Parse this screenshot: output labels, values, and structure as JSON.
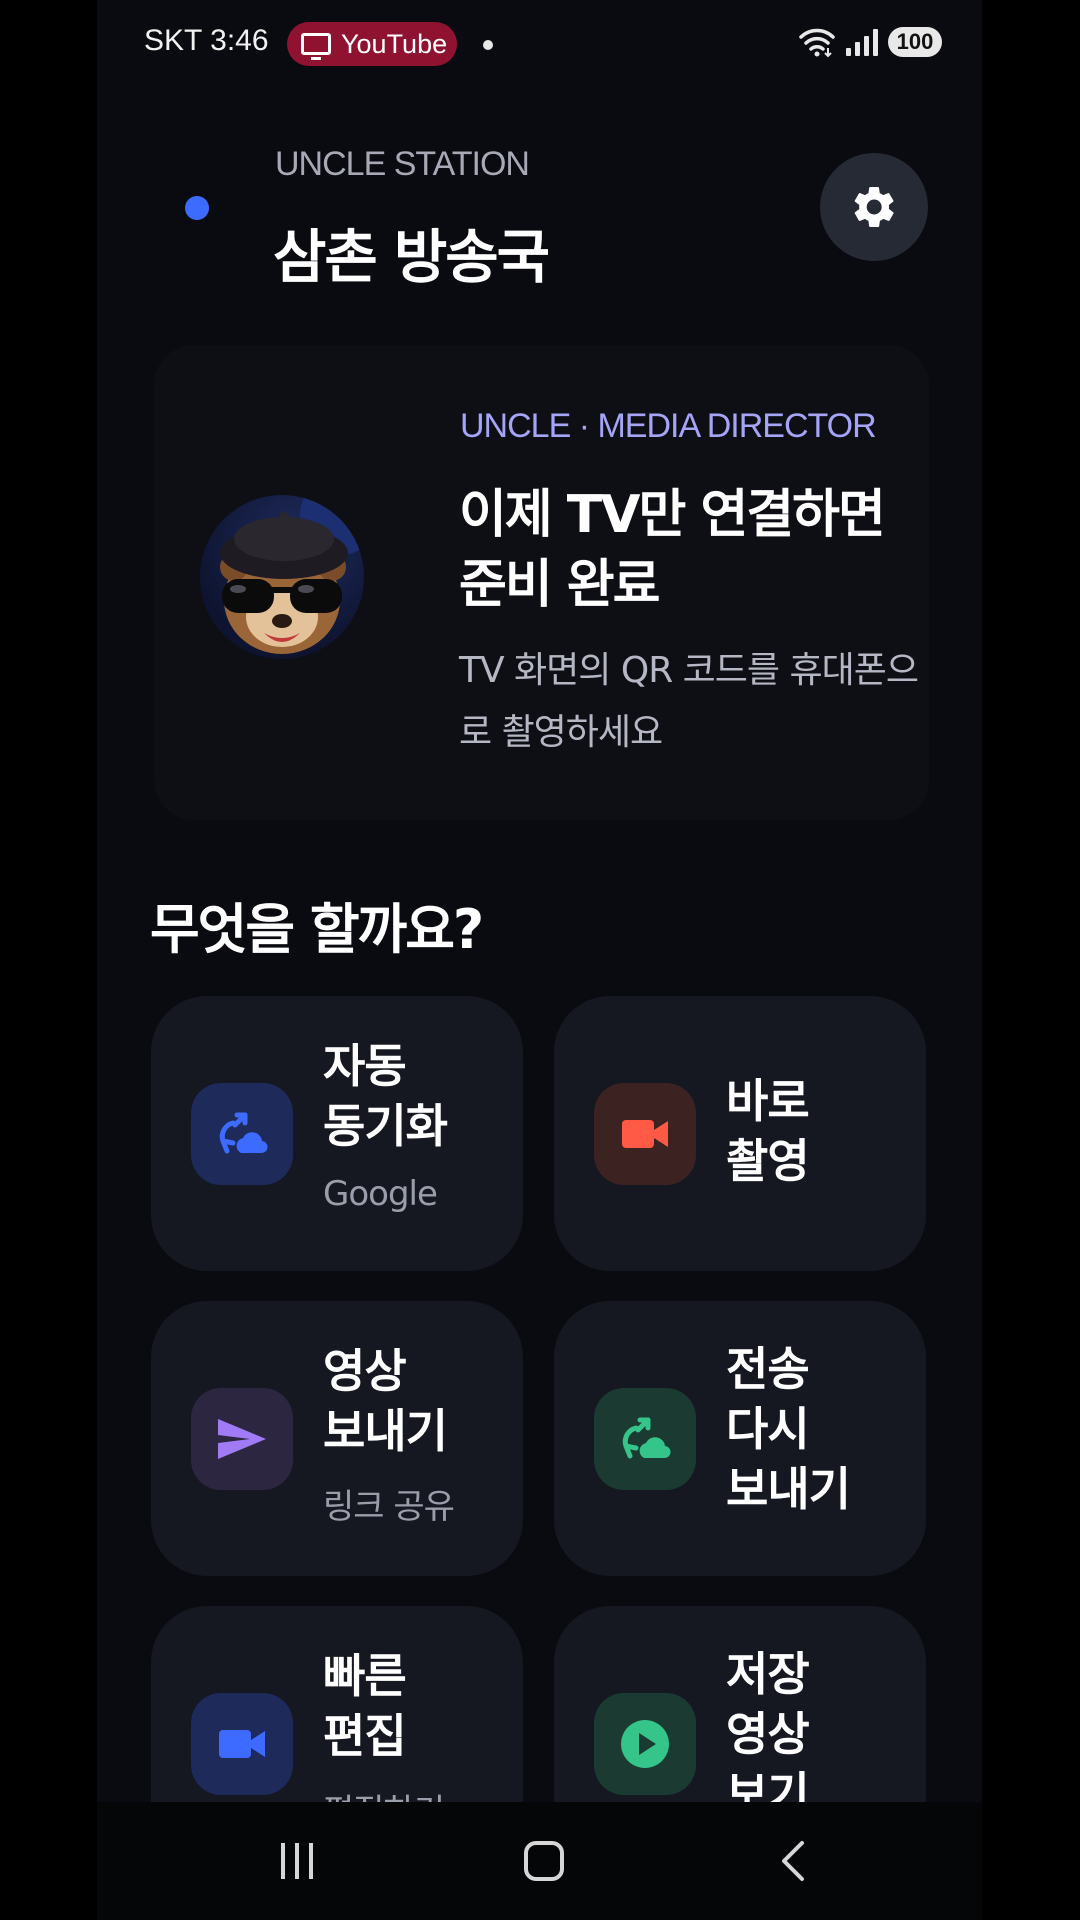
{
  "status_bar": {
    "carrier_time": "SKT 3:46",
    "app_chip": "YouTube",
    "app_chip_icon": "tv-icon",
    "battery": "100"
  },
  "header": {
    "subtitle": "UNCLE STATION",
    "title": "삼촌 방송국",
    "settings_icon": "gear-icon"
  },
  "hero": {
    "kicker": "UNCLE · MEDIA DIRECTOR",
    "title": "이제 TV만 연결하면 준비 완료",
    "description": "TV 화면의 QR 코드를 휴대폰으로 촬영하세요",
    "avatar": "otter-character-avatar"
  },
  "section": {
    "title": "무엇을 할까요?"
  },
  "tiles": [
    {
      "label": "자동\n동기화",
      "sub": "Google",
      "icon": "cloud-sync-icon",
      "color": "#3d6bff",
      "bg": "#1d2a5a"
    },
    {
      "label": "바로\n촬영",
      "sub": "",
      "icon": "video-camera-icon",
      "color": "#ff5a45",
      "bg": "#3d2222"
    },
    {
      "label": "영상\n보내기",
      "sub": "링크 공유",
      "icon": "send-icon",
      "color": "#a07bf5",
      "bg": "#2c2640"
    },
    {
      "label": "전송\n다시\n보내기",
      "sub": "",
      "icon": "cloud-sync-icon",
      "color": "#35c48a",
      "bg": "#1a3a32"
    },
    {
      "label": "빠른\n편집",
      "sub": "편집하기",
      "icon": "video-camera-icon",
      "color": "#3d6bff",
      "bg": "#1d2a5a"
    },
    {
      "label": "저장\n영상\n보기",
      "sub": "",
      "icon": "play-circle-icon",
      "color": "#35c48a",
      "bg": "#1a3a32"
    }
  ],
  "nav": {
    "recents_icon": "recents-icon",
    "home_icon": "home-icon",
    "back_icon": "back-icon"
  }
}
